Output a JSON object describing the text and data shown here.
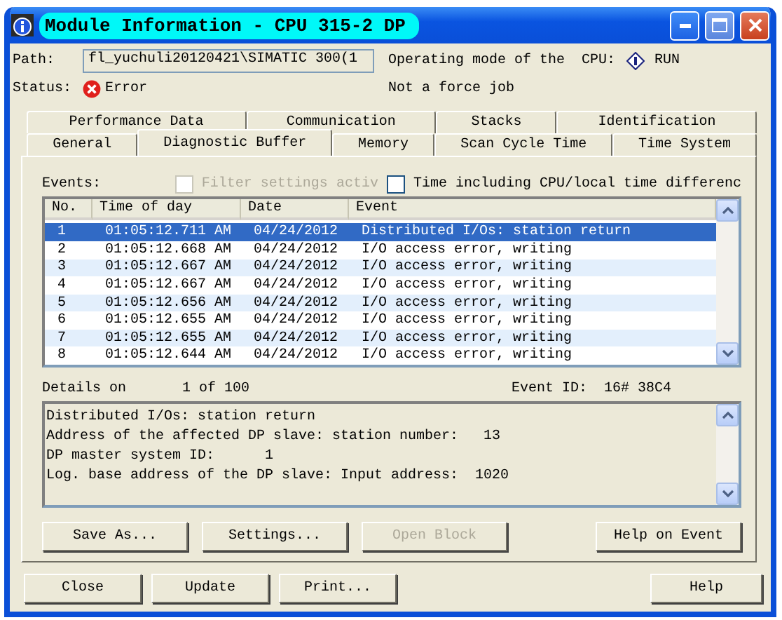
{
  "window": {
    "title": "Module Information - CPU 315-2 DP"
  },
  "path": {
    "label": "Path:",
    "value": "fl_yuchuli20120421\\SIMATIC 300(1"
  },
  "operating_mode": {
    "label": "Operating mode of the  CPU:",
    "value": "RUN"
  },
  "status": {
    "label": "Status:",
    "value": "Error"
  },
  "force_job": "Not a force job",
  "tab_rows": [
    {
      "tabs": [
        {
          "label": "Performance Data",
          "selected": false
        },
        {
          "label": "Communication",
          "selected": false
        },
        {
          "label": "Stacks",
          "selected": false
        },
        {
          "label": "Identification",
          "selected": false
        }
      ]
    },
    {
      "tabs": [
        {
          "label": "General",
          "selected": false
        },
        {
          "label": "Diagnostic Buffer",
          "selected": true
        },
        {
          "label": "Memory",
          "selected": false
        },
        {
          "label": "Scan Cycle Time",
          "selected": false
        },
        {
          "label": "Time System",
          "selected": false
        }
      ]
    }
  ],
  "events_label": "Events:",
  "options": [
    {
      "label": "Filter settings activ",
      "checked": false,
      "disabled": true
    },
    {
      "label": "Time including CPU/local time differenc",
      "checked": false,
      "disabled": false
    }
  ],
  "table": {
    "columns": [
      "No.",
      "Time of day",
      "Date",
      "Event"
    ],
    "rows": [
      {
        "cells": [
          "1",
          "01:05:12.711 AM",
          "04/24/2012",
          "Distributed I/Os: station return"
        ],
        "selected": true
      },
      {
        "cells": [
          "2",
          "01:05:12.668 AM",
          "04/24/2012",
          "I/O access error, writing"
        ],
        "selected": false
      },
      {
        "cells": [
          "3",
          "01:05:12.667 AM",
          "04/24/2012",
          "I/O access error, writing"
        ],
        "selected": false
      },
      {
        "cells": [
          "4",
          "01:05:12.667 AM",
          "04/24/2012",
          "I/O access error, writing"
        ],
        "selected": false
      },
      {
        "cells": [
          "5",
          "01:05:12.656 AM",
          "04/24/2012",
          "I/O access error, writing"
        ],
        "selected": false
      },
      {
        "cells": [
          "6",
          "01:05:12.655 AM",
          "04/24/2012",
          "I/O access error, writing"
        ],
        "selected": false
      },
      {
        "cells": [
          "7",
          "01:05:12.655 AM",
          "04/24/2012",
          "I/O access error, writing"
        ],
        "selected": false
      },
      {
        "cells": [
          "8",
          "01:05:12.644 AM",
          "04/24/2012",
          "I/O access error, writing"
        ],
        "selected": false
      }
    ]
  },
  "details": {
    "label": "Details on",
    "count": "1 of 100",
    "event_id": "Event ID:  16# 38C4",
    "lines": [
      "Distributed I/Os: station return",
      "Address of the affected DP slave: station number:   13",
      "DP master system ID:      1",
      "Log. base address of the DP slave: Input address:  1020"
    ]
  },
  "panel_buttons": [
    {
      "label": "Save As...",
      "disabled": false
    },
    {
      "label": "Settings...",
      "disabled": false
    },
    {
      "label": "Open Block",
      "disabled": true
    },
    {
      "label": "Help on Event",
      "disabled": false
    }
  ],
  "footer_buttons": [
    {
      "label": "Close"
    },
    {
      "label": "Update"
    },
    {
      "label": "Print..."
    },
    {
      "label": "Help"
    }
  ]
}
